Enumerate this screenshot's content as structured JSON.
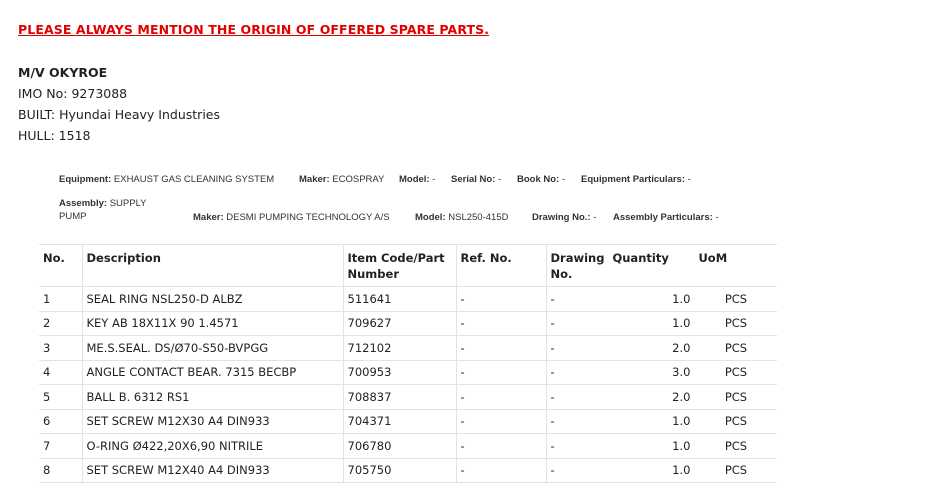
{
  "notice": "PLEASE ALWAYS MENTION THE ORIGIN OF OFFERED SPARE PARTS.",
  "vessel": {
    "name": "M/V OKYROE",
    "imo": "IMO No: 9273088",
    "built": "BUILT: Hyundai Heavy Industries",
    "hull": "HULL: 1518"
  },
  "equipment": {
    "equipment_label": "Equipment:",
    "equipment_value": "EXHAUST GAS CLEANING SYSTEM",
    "maker_label": "Maker:",
    "maker_value": "ECOSPRAY",
    "model_label": "Model:",
    "model_value": "-",
    "serial_label": "Serial No:",
    "serial_value": "-",
    "book_label": "Book No:",
    "book_value": "-",
    "particulars_label": "Equipment Particulars:",
    "particulars_value": "-"
  },
  "assembly": {
    "assembly_label": "Assembly:",
    "assembly_value": "SUPPLY PUMP",
    "maker_label": "Maker:",
    "maker_value": "DESMI PUMPING TECHNOLOGY A/S",
    "model_label": "Model:",
    "model_value": "NSL250-415D",
    "drawing_label": "Drawing No.:",
    "drawing_value": "-",
    "particulars_label": "Assembly Particulars:",
    "particulars_value": "-"
  },
  "table": {
    "headers": {
      "no": "No.",
      "description": "Description",
      "item_code": "Item Code/Part Number",
      "ref_no": "Ref. No.",
      "drawing_no": "Drawing No.",
      "quantity": "Quantity",
      "uom": "UoM"
    },
    "rows": [
      {
        "no": "1",
        "description": "SEAL RING NSL250-D ALBZ",
        "item_code": "511641",
        "ref_no": "-",
        "drawing_no": "-",
        "quantity": "1.0",
        "uom": "PCS"
      },
      {
        "no": "2",
        "description": "KEY AB 18X11X 90 1.4571",
        "item_code": "709627",
        "ref_no": "-",
        "drawing_no": "-",
        "quantity": "1.0",
        "uom": "PCS"
      },
      {
        "no": "3",
        "description": "ME.S.SEAL. DS/Ø70-S50-BVPGG",
        "item_code": "712102",
        "ref_no": "-",
        "drawing_no": "-",
        "quantity": "2.0",
        "uom": "PCS"
      },
      {
        "no": "4",
        "description": "ANGLE CONTACT BEAR. 7315 BECBP",
        "item_code": "700953",
        "ref_no": "-",
        "drawing_no": "-",
        "quantity": "3.0",
        "uom": "PCS"
      },
      {
        "no": "5",
        "description": "BALL B. 6312 RS1",
        "item_code": "708837",
        "ref_no": "-",
        "drawing_no": "-",
        "quantity": "2.0",
        "uom": "PCS"
      },
      {
        "no": "6",
        "description": "SET SCREW M12X30 A4 DIN933",
        "item_code": "704371",
        "ref_no": "-",
        "drawing_no": "-",
        "quantity": "1.0",
        "uom": "PCS"
      },
      {
        "no": "7",
        "description": "O-RING Ø422,20X6,90 NITRILE",
        "item_code": "706780",
        "ref_no": "-",
        "drawing_no": "-",
        "quantity": "1.0",
        "uom": "PCS"
      },
      {
        "no": "8",
        "description": "SET SCREW M12X40 A4 DIN933",
        "item_code": "705750",
        "ref_no": "-",
        "drawing_no": "-",
        "quantity": "1.0",
        "uom": "PCS"
      }
    ]
  }
}
